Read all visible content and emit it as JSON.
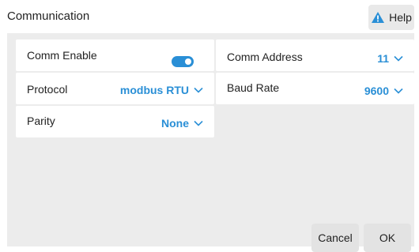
{
  "window": {
    "title": "Communication"
  },
  "help": {
    "label": "Help",
    "icon": "warning-triangle-icon",
    "icon_color": "#2a8fd6"
  },
  "settings": {
    "comm_enable": {
      "label": "Comm Enable",
      "enabled": true
    },
    "comm_address": {
      "label": "Comm Address",
      "value": "11"
    },
    "protocol": {
      "label": "Protocol",
      "value": "modbus RTU"
    },
    "baud_rate": {
      "label": "Baud Rate",
      "value": "9600"
    },
    "parity": {
      "label": "Parity",
      "value": "None"
    }
  },
  "footer": {
    "cancel_label": "Cancel",
    "ok_label": "OK"
  },
  "colors": {
    "accent": "#2a8fd6",
    "panel_bg": "#ececec",
    "card_bg": "#ffffff"
  }
}
